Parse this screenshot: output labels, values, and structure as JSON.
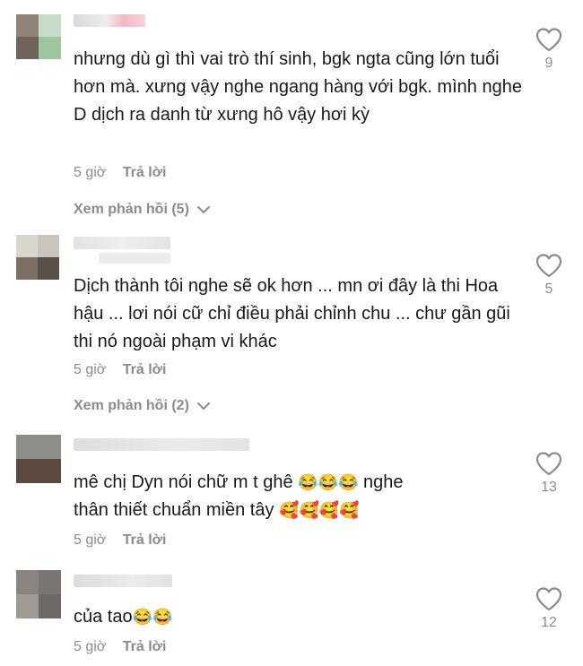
{
  "comments": [
    {
      "text": "nhưng dù gì thì vai trò thí sinh, bgk ngta cũng lớn tuổi hơn mà. xưng vậy nghe ngang hàng với bgk. mình nghe D dịch ra danh từ xưng hô vậy hơi kỳ",
      "time": "5 giờ",
      "reply": "Trả lời",
      "view_replies": "Xem phản hồi (5)",
      "likes": "9"
    },
    {
      "text": "Dịch thành tôi nghe sẽ ok hơn ... mn ơi đây là thi Hoa hậu ... lơi nói cữ chỉ điều phải chỉnh chu ... chư gần gũi thi nó ngoài phạm vi khác",
      "time": "5 giờ",
      "reply": "Trả lời",
      "view_replies": "Xem phản hồi (2)",
      "likes": "5"
    },
    {
      "text_line1": "mê chị Dyn nói chữ m t ghê",
      "emoji_line1": "😂😂😂",
      "text_line1b": " nghe",
      "text_line2": "thân thiết chuẩn miền tây ",
      "emoji_line2": "🥰🥰🥰🥰",
      "time": "5 giờ",
      "reply": "Trả lời",
      "likes": "13"
    },
    {
      "text": "của tao",
      "emoji": "😂😂",
      "time": "5 giờ",
      "reply": "Trả lời",
      "likes": "12"
    }
  ],
  "colors": {
    "text": "#161823",
    "muted": "#8a8b91"
  },
  "icons": {
    "like": "heart-outline-icon",
    "expand": "chevron-down-icon"
  }
}
